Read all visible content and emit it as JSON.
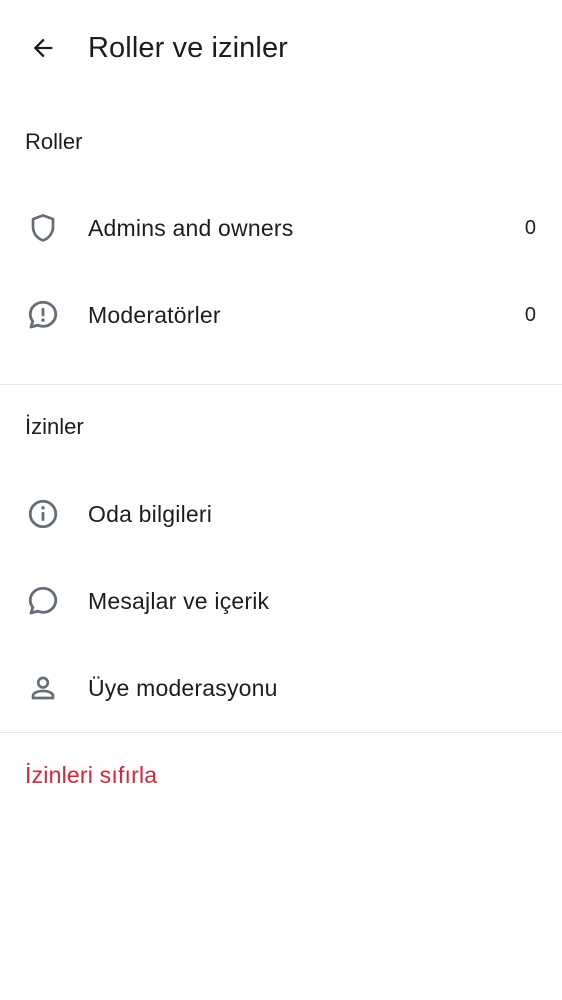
{
  "header": {
    "title": "Roller ve izinler",
    "back_icon": "arrow-left-icon"
  },
  "roles": {
    "heading": "Roller",
    "items": [
      {
        "label": "Admins and owners",
        "count": "0",
        "icon": "shield-icon"
      },
      {
        "label": "Moderatörler",
        "count": "0",
        "icon": "alert-chat-icon"
      }
    ]
  },
  "permissions": {
    "heading": "İzinler",
    "items": [
      {
        "label": "Oda bilgileri",
        "icon": "info-icon"
      },
      {
        "label": "Mesajlar ve içerik",
        "icon": "chat-bubble-icon"
      },
      {
        "label": "Üye moderasyonu",
        "icon": "person-icon"
      }
    ]
  },
  "reset": {
    "label": "İzinleri sıfırla",
    "color": "#e0213a"
  },
  "colors": {
    "text": "#1b1d22",
    "icon": "#656d77",
    "divider": "#e3e5e8",
    "danger": "#e0213a"
  }
}
